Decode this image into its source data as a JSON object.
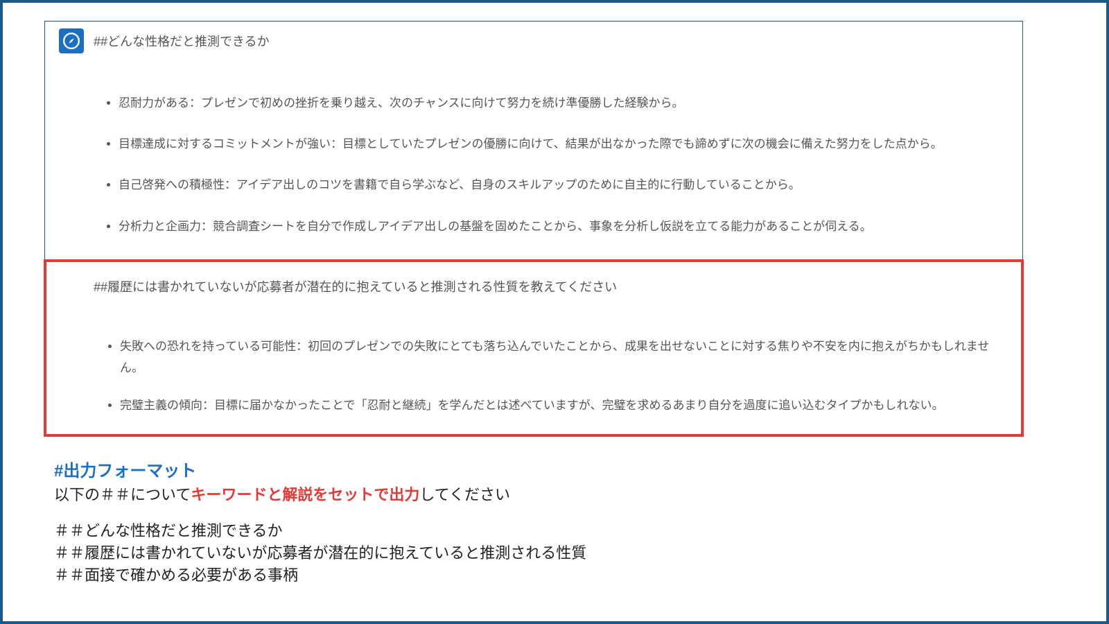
{
  "icon": "compass-icon",
  "section1": {
    "title": "##どんな性格だと推測できるか",
    "items": [
      "忍耐力がある：プレゼンで初めの挫折を乗り越え、次のチャンスに向けて努力を続け準優勝した経験から。",
      "目標達成に対するコミットメントが強い：目標としていたプレゼンの優勝に向けて、結果が出なかった際でも諦めずに次の機会に備えた努力をした点から。",
      "自己啓発への積極性：アイデア出しのコツを書籍で自ら学ぶなど、自身のスキルアップのために自主的に行動していることから。",
      "分析力と企画力：競合調査シートを自分で作成しアイデア出しの基盤を固めたことから、事象を分析し仮説を立てる能力があることが伺える。"
    ]
  },
  "section2": {
    "title": "##履歴には書かれていないが応募者が潜在的に抱えていると推測される性質を教えてください",
    "items": [
      "失敗への恐れを持っている可能性：初回のプレゼンでの失敗にとても落ち込んでいたことから、成果を出せないことに対する焦りや不安を内に抱えがちかもしれません。",
      "完璧主義の傾向：目標に届かなかったことで「忍耐と継続」を学んだとは述べていますが、完璧を求めるあまり自分を過度に追い込むタイプかもしれない。"
    ]
  },
  "bottom": {
    "heading": "#出力フォーマット",
    "line_prefix": "以下の＃＃について",
    "line_keyword": "キーワードと解説をセットで出力",
    "line_suffix": "してください",
    "sub1": "＃＃どんな性格だと推測できるか",
    "sub2": "＃＃履歴には書かれていないが応募者が潜在的に抱えていると推測される性質",
    "sub3": "＃＃面接で確かめる必要がある事柄"
  }
}
